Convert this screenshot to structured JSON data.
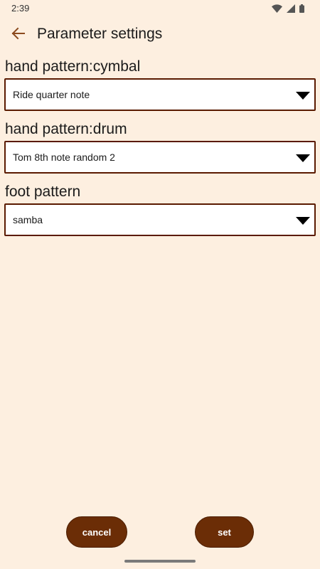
{
  "status_bar": {
    "time": "2:39",
    "icons": [
      "wifi-icon",
      "signal-icon",
      "battery-icon"
    ]
  },
  "app_bar": {
    "title": "Parameter settings",
    "back_icon": "back-arrow-icon"
  },
  "fields": {
    "cymbal": {
      "label": "hand pattern:cymbal",
      "value": "Ride quarter note"
    },
    "drum": {
      "label": "hand pattern:drum",
      "value": "Tom 8th note random 2"
    },
    "foot": {
      "label": "foot pattern",
      "value": "samba"
    }
  },
  "buttons": {
    "cancel": "cancel",
    "set": "set"
  },
  "colors": {
    "background": "#FDEFE0",
    "accent": "#6B2D06",
    "dropdown_border": "#5A1A00",
    "back_arrow": "#8B4A1E"
  }
}
